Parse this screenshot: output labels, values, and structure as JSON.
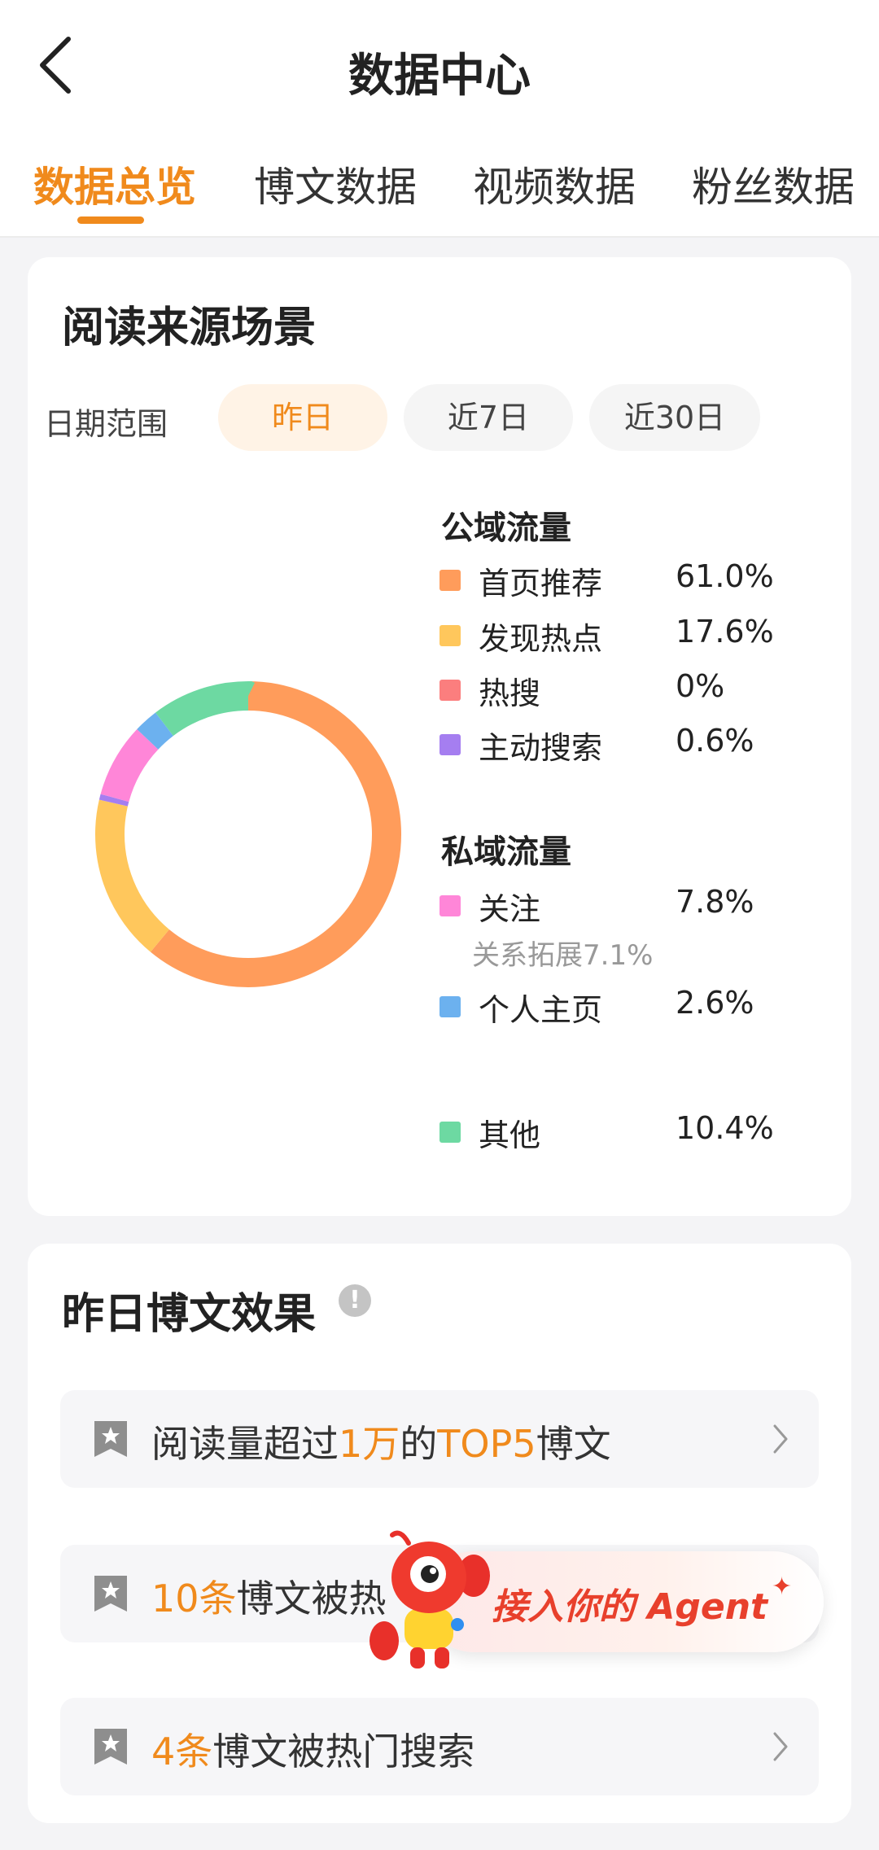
{
  "header": {
    "title": "数据中心",
    "back_icon": "chevron-left-icon",
    "tabs": [
      {
        "label": "数据总览",
        "active": true
      },
      {
        "label": "博文数据",
        "active": false
      },
      {
        "label": "视频数据",
        "active": false
      },
      {
        "label": "粉丝数据",
        "active": false
      }
    ]
  },
  "reading_source": {
    "title": "阅读来源场景",
    "date_range_label": "日期范围",
    "ranges": [
      {
        "label": "昨日",
        "selected": true
      },
      {
        "label": "近7日",
        "selected": false
      },
      {
        "label": "近30日",
        "selected": false
      }
    ],
    "public_heading": "公域流量",
    "private_heading": "私域流量",
    "public_items": [
      {
        "label": "首页推荐",
        "value": "61.0%",
        "color": "#ff9c5b"
      },
      {
        "label": "发现热点",
        "value": "17.6%",
        "color": "#ffc75c"
      },
      {
        "label": "热搜",
        "value": "0%",
        "color": "#fb7e7e"
      },
      {
        "label": "主动搜索",
        "value": "0.6%",
        "color": "#a57ef0"
      }
    ],
    "private_items": [
      {
        "label": "关注",
        "value": "7.8%",
        "color": "#ff86d8",
        "sub": "关系拓展7.1%"
      },
      {
        "label": "个人主页",
        "value": "2.6%",
        "color": "#6cb1ef"
      }
    ],
    "other": {
      "label": "其他",
      "value": "10.4%",
      "color": "#6dd9a2"
    }
  },
  "chart_data": {
    "type": "pie",
    "donut": true,
    "categories": [
      "首页推荐",
      "发现热点",
      "热搜",
      "主动搜索",
      "关注",
      "个人主页",
      "其他"
    ],
    "values": [
      61.0,
      17.6,
      0,
      0.6,
      7.8,
      2.6,
      10.4
    ],
    "colors": [
      "#ff9c5b",
      "#ffc75c",
      "#fb7e7e",
      "#a57ef0",
      "#ff86d8",
      "#6cb1ef",
      "#6dd9a2"
    ]
  },
  "post_effect": {
    "title": "昨日博文效果",
    "info_icon": "!",
    "items": [
      {
        "parts": [
          "阅读量超过",
          "1万",
          "的",
          "TOP5",
          "博文"
        ]
      },
      {
        "parts": [
          "",
          "10条",
          "博文被热",
          "",
          ""
        ]
      },
      {
        "parts": [
          "",
          "4条",
          "博文被热门搜索",
          "",
          ""
        ]
      }
    ]
  },
  "agent_banner": {
    "text": "接入你的 Agent"
  },
  "colors": {
    "accent": "#f08a1c",
    "agent_red": "#e8402c"
  }
}
